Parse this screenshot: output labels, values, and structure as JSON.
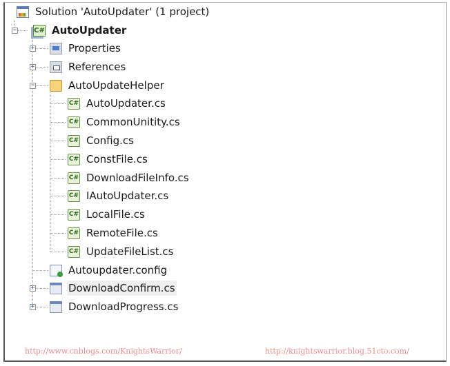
{
  "tree": {
    "solution": {
      "label": "Solution 'AutoUpdater' (1 project)",
      "icon": "solution-icon"
    },
    "project": {
      "label": "AutoUpdater",
      "icon": "csharp-project-icon",
      "expanded": true
    },
    "items": [
      {
        "label": "Properties",
        "icon": "properties-icon",
        "expander": "plus"
      },
      {
        "label": "References",
        "icon": "references-icon",
        "expander": "plus"
      },
      {
        "label": "AutoUpdateHelper",
        "icon": "folder-open-icon",
        "expander": "minus"
      },
      {
        "label": "AutoUpdater.cs",
        "icon": "csharp-file-icon",
        "child": true
      },
      {
        "label": "CommonUnitity.cs",
        "icon": "csharp-file-icon",
        "child": true
      },
      {
        "label": "Config.cs",
        "icon": "csharp-file-icon",
        "child": true
      },
      {
        "label": "ConstFile.cs",
        "icon": "csharp-file-icon",
        "child": true
      },
      {
        "label": "DownloadFileInfo.cs",
        "icon": "csharp-file-icon",
        "child": true
      },
      {
        "label": "IAutoUpdater.cs",
        "icon": "csharp-file-icon",
        "child": true
      },
      {
        "label": "LocalFile.cs",
        "icon": "csharp-file-icon",
        "child": true
      },
      {
        "label": "RemoteFile.cs",
        "icon": "csharp-file-icon",
        "child": true
      },
      {
        "label": "UpdateFileList.cs",
        "icon": "csharp-file-icon",
        "child": true
      },
      {
        "label": "Autoupdater.config",
        "icon": "config-file-icon"
      },
      {
        "label": "DownloadConfirm.cs",
        "icon": "form-icon",
        "expander": "plus",
        "selected": true
      },
      {
        "label": "DownloadProgress.cs",
        "icon": "form-icon",
        "expander": "plus"
      }
    ]
  },
  "watermarks": {
    "left": "http://www.cnblogs.com/KnightsWarrior/",
    "right": "http://knightswarrior.blog.51cto.com/"
  }
}
